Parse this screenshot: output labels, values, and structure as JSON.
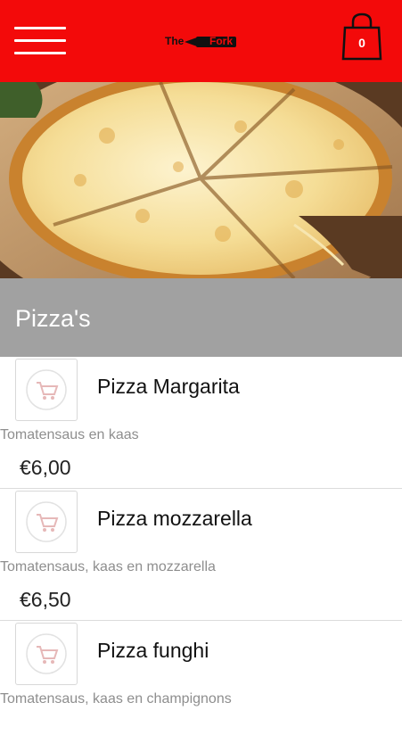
{
  "header": {
    "menu_icon": "hamburger-menu-icon",
    "logo": {
      "word1": "The",
      "word2": "Fork"
    },
    "cart": {
      "icon": "shopping-bag-icon",
      "count": "0"
    },
    "colors": {
      "brand": "#f30a0a",
      "category_bar": "#a1a1a1"
    }
  },
  "category": {
    "title": "Pizza's"
  },
  "products": [
    {
      "name": "Pizza Margarita",
      "description": "Tomatensaus en kaas",
      "price": "€6,00",
      "icon": "add-to-cart-icon"
    },
    {
      "name": "Pizza mozzarella",
      "description": "Tomatensaus, kaas en mozzarella",
      "price": "€6,50",
      "icon": "add-to-cart-icon"
    },
    {
      "name": "Pizza funghi",
      "description": "Tomatensaus, kaas en champignons",
      "price": "",
      "icon": "add-to-cart-icon"
    }
  ]
}
